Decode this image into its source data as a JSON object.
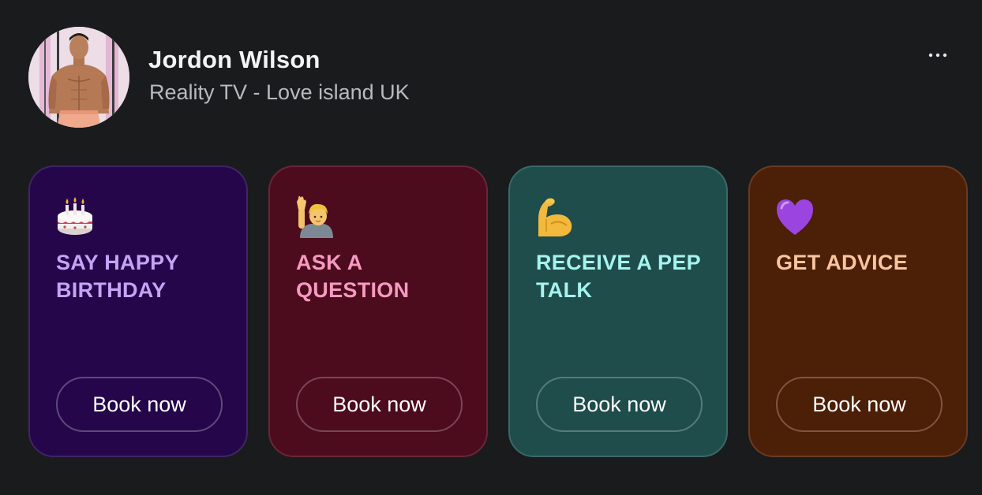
{
  "profile": {
    "name": "Jordon Wilson",
    "subtitle": "Reality TV - Love island UK",
    "more_icon": "more-horizontal-icon"
  },
  "cards": [
    {
      "title": "SAY HAPPY BIRTHDAY",
      "icon": "birthday-cake-icon",
      "button_label": "Book now",
      "bg": "#25064a",
      "border": "#3f2566",
      "accent": "#c5a3f5",
      "button_border": "#5d4a7c"
    },
    {
      "title": "ASK A QUESTION",
      "icon": "raising-hand-icon",
      "button_label": "Book now",
      "bg": "#4d0b1e",
      "border": "#6a2638",
      "accent": "#f59ac0",
      "button_border": "#7a4656"
    },
    {
      "title": "RECEIVE A PEP TALK",
      "icon": "flexed-biceps-icon",
      "button_label": "Book now",
      "bg": "#1f4d4b",
      "border": "#3a6967",
      "accent": "#a6f3ef",
      "button_border": "#557c7a"
    },
    {
      "title": "GET ADVICE",
      "icon": "purple-heart-icon",
      "button_label": "Book now",
      "bg": "#4c1f07",
      "border": "#6a3b22",
      "accent": "#f8c59e",
      "button_border": "#7d5641"
    }
  ]
}
